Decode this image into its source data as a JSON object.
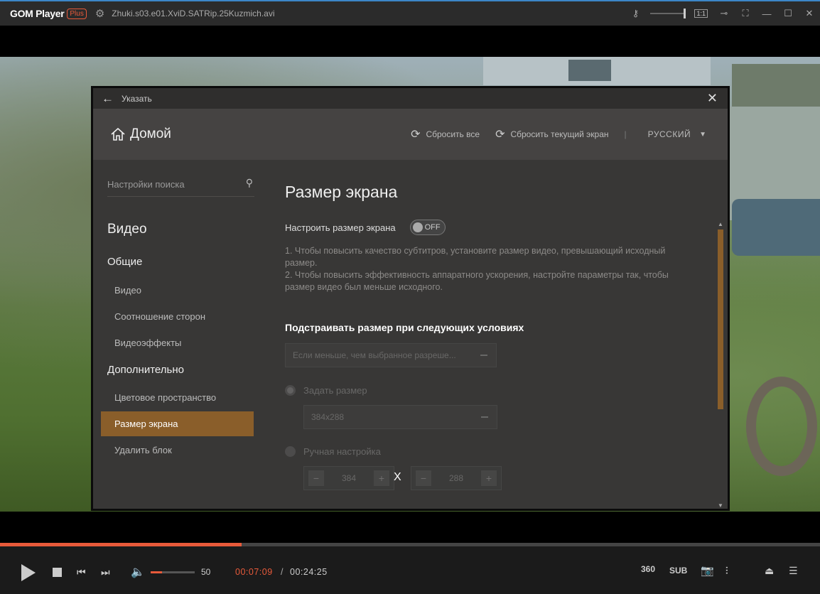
{
  "titlebar": {
    "logo": "GOM Player",
    "plus": "Plus",
    "filename": "Zhuki.s03.e01.XviD.SATRip.25Kuzmich.avi",
    "ratio_label": "1:1"
  },
  "dialog": {
    "top_title": "Указать",
    "home_label": "Домой",
    "reset_all": "Сбросить все",
    "reset_current": "Сбросить текущий экран",
    "separator": "|",
    "language": "РУССКИЙ",
    "sidebar": {
      "search_placeholder": "Настройки поиска",
      "section": "Видео",
      "group_general": "Общие",
      "item_video": "Видео",
      "item_aspect": "Соотношение сторон",
      "item_effects": "Видеоэффекты",
      "group_advanced": "Дополнительно",
      "item_colorspace": "Цветовое пространство",
      "item_screen_size": "Размер экрана",
      "item_delete_block": "Удалить блок"
    },
    "content": {
      "title": "Размер экрана",
      "toggle_label": "Настроить размер экрана",
      "toggle_state": "OFF",
      "desc_line1": "1. Чтобы повысить качество субтитров, установите размер видео, превышающий исходный размер.",
      "desc_line2": "2. Чтобы повысить эффективность аппаратного ускорения, настройте параметры так, чтобы размер видео был меньше исходного.",
      "condition_title": "Подстраивать размер при следующих условиях",
      "condition_select": "Если меньше, чем выбранное разреше...",
      "radio_set_size": "Задать размер",
      "size_select": "384x288",
      "radio_manual": "Ручная настройка",
      "width_value": "384",
      "height_value": "288",
      "times": "X"
    }
  },
  "controls": {
    "progress": 0.295,
    "volume": 50,
    "volume_label": "50",
    "time_current": "00:07:09",
    "time_sep": "/",
    "time_total": "00:24:25",
    "btn_360": "360",
    "btn_sub": "SUB"
  },
  "colors": {
    "accent": "#e85a3a",
    "active_item": "#8a5e2a",
    "dialog_bg": "#383736"
  }
}
